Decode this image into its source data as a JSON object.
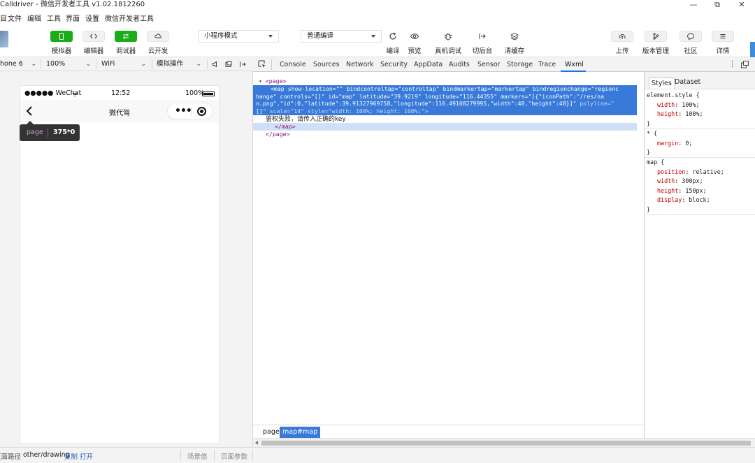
{
  "window": {
    "title": "Calldriver - 微信开发者工具 v1.02.1812260",
    "controls": [
      "—",
      "⧉",
      "✕"
    ]
  },
  "menu": [
    "目",
    "文件",
    "编辑",
    "工具",
    "界面",
    "设置",
    "微信开发者工具"
  ],
  "toolbar": {
    "simulator_label": "模拟器",
    "editor_label": "编辑器",
    "debugger_label": "调试器",
    "cloud_label": "云开发",
    "mode_select": "小程序模式",
    "compile_select": "普通编译",
    "compile_label": "编译",
    "preview_label": "预览",
    "remote_debug_label": "真机调试",
    "backstage_label": "切后台",
    "clear_cache_label": "清缓存",
    "upload_label": "上传",
    "version_label": "版本管理",
    "community_label": "社区",
    "details_label": "详情"
  },
  "devicebar": {
    "device": "hone 6",
    "zoom": "100%",
    "network": "WiFi",
    "operation": "模拟操作"
  },
  "phone": {
    "carrier": "●●●●● WeChat",
    "time": "12:52",
    "battery": "100%",
    "nav_title": "微代驾",
    "tooltip_tag": "page",
    "tooltip_size": "375*0"
  },
  "bottombar": {
    "path_label": "页面路径",
    "path": "other/drawing",
    "copy": "复制",
    "open": "打开",
    "scene": "场景值",
    "params": "页面参数"
  },
  "devtools": {
    "tabs": [
      "Console",
      "Sources",
      "Network",
      "Security",
      "AppData",
      "Audits",
      "Sensor",
      "Storage",
      "Trace",
      "Wxml"
    ],
    "active_tab": "Wxml",
    "wxml": {
      "page_open": "<page>",
      "map_tag": "<map",
      "attrs": [
        {
          "name": "show-location",
          "value": "\"\""
        },
        {
          "name": "bindcontroltap",
          "value": "\"controltap\""
        },
        {
          "name": "bindmarkertap",
          "value": "\"markertap\""
        },
        {
          "name": "bindregionchange",
          "value": "\"regionc"
        }
      ],
      "line2_prefix": "hange\"",
      "line2_attrs": [
        {
          "name": "controls",
          "value": "\"[]\""
        },
        {
          "name": "id",
          "value": "\"map\""
        },
        {
          "name": "latitude",
          "value": "\"39.9219\""
        },
        {
          "name": "longitude",
          "value": "\"116.44355\""
        },
        {
          "name": "markers",
          "value": "\"[{\"iconPath\":\"/res/na"
        }
      ],
      "line3": "n.png\",\"id\":0,\"latitude\":39.91327969758,\"longitude\":116.49108279995,\"width\":48,\"height\":48}]\"",
      "line3_attr": "polyline=\"",
      "line4_a": "[]\"",
      "line4_scale": "scale=\"14\"",
      "line4_style": "style=\"width: 100%; height: 100%;\">",
      "text": "鉴权失败，请传入正确的key",
      "map_close": "</map>",
      "page_close": "</page>"
    },
    "breadcrumb": [
      "page",
      "map#map"
    ],
    "styles": {
      "tabs": [
        "Styles",
        "Dataset"
      ],
      "rules": [
        {
          "selector": "element.style {",
          "props": [
            [
              "width",
              "100%;"
            ],
            [
              "height",
              "100%;"
            ]
          ]
        },
        {
          "selector": "* {",
          "props": [
            [
              "margin",
              "0;"
            ]
          ]
        },
        {
          "selector": "map {",
          "props": [
            [
              "position",
              "relative;"
            ],
            [
              "width",
              "300px;"
            ],
            [
              "height",
              "150px;"
            ],
            [
              "display",
              "block;"
            ]
          ]
        }
      ]
    }
  },
  "colors": {
    "accent_green": "#1aad19",
    "selection_blue": "#3879d9"
  }
}
